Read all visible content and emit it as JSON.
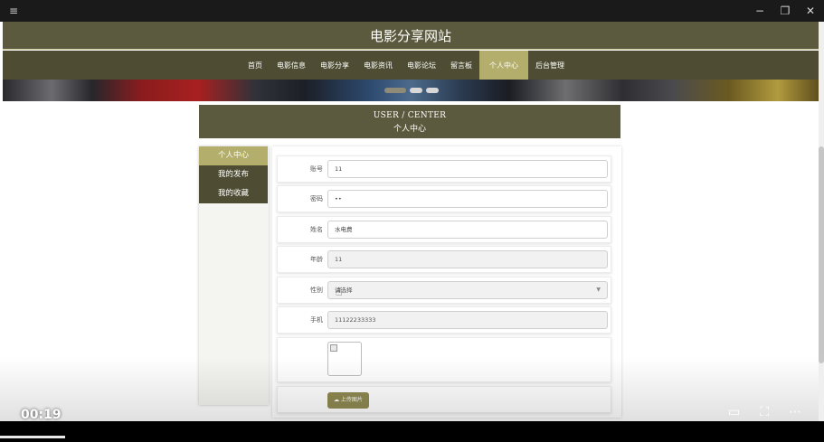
{
  "chrome": {
    "menu_icon": "≡",
    "minimize_icon": "−",
    "restore_icon": "❐",
    "close_icon": "✕"
  },
  "site": {
    "title": "电影分享网站"
  },
  "nav": {
    "items": [
      "首页",
      "电影信息",
      "电影分享",
      "电影资讯",
      "电影论坛",
      "留言板",
      "个人中心",
      "后台管理"
    ],
    "active": "个人中心"
  },
  "user_center": {
    "title_en": "USER / CENTER",
    "title_cn": "个人中心"
  },
  "side_menu": {
    "items": [
      "个人中心",
      "我的发布",
      "我的收藏"
    ],
    "active": "个人中心"
  },
  "form": {
    "account_label": "账号",
    "account_value": "11",
    "password_label": "密码",
    "password_value": "••",
    "name_label": "姓名",
    "name_value": "水电费",
    "age_label": "年龄",
    "age_value": "11",
    "gender_label": "性别",
    "gender_value": "请选择",
    "phone_label": "手机",
    "phone_value": "11122233333",
    "upload_label": "上传图片"
  },
  "video": {
    "time": "00:19"
  },
  "colors": {
    "header_bg": "#5b5a3e",
    "nav_bg": "#4e4d33",
    "accent": "#b3ae6c",
    "upload_btn": "#8f8a52"
  }
}
